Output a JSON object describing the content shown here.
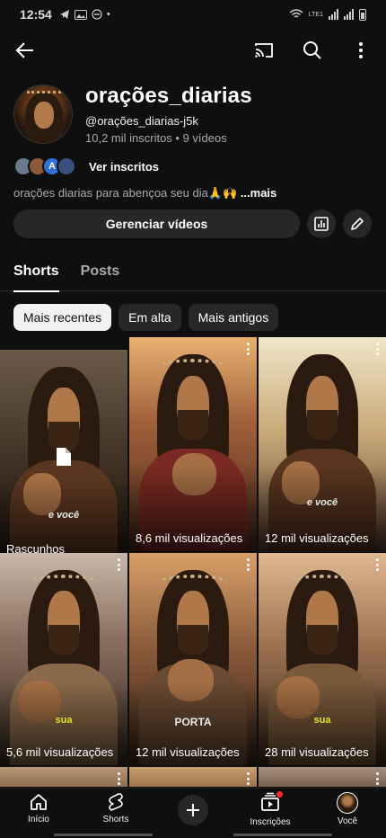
{
  "status_bar": {
    "time": "12:54",
    "network_label": "LTE1"
  },
  "top_bar": {
    "back_icon": "arrow-left-icon",
    "icons": [
      "cast-icon",
      "search-icon",
      "more-vert-icon"
    ]
  },
  "channel": {
    "name": "orações_diarias",
    "handle": "@orações_diarias-j5k",
    "stats": "10,2 mil inscritos • 9 vídeos",
    "subscribers_link": "Ver inscritos",
    "subscriber_avatar_letter": "A",
    "description": "orações diarias para abençoa seu dia🙏🙌",
    "more_label": "...mais"
  },
  "actions": {
    "manage_label": "Gerenciar vídeos",
    "analytics_icon": "analytics-icon",
    "edit_icon": "pencil-icon"
  },
  "tabs": [
    {
      "label": "Shorts",
      "active": true
    },
    {
      "label": "Posts",
      "active": false
    }
  ],
  "chips": [
    {
      "label": "Mais recentes",
      "active": true
    },
    {
      "label": "Em alta",
      "active": false
    },
    {
      "label": "Mais antigos",
      "active": false
    }
  ],
  "shorts": [
    {
      "caption": "Rascunhos",
      "overlay": "e você",
      "is_draft": true
    },
    {
      "caption": "8,6 mil visualizações",
      "overlay": ""
    },
    {
      "caption": "12 mil visualizações",
      "overlay": "e você"
    },
    {
      "caption": "5,6 mil visualizações",
      "overlay": "sua"
    },
    {
      "caption": "12 mil visualizações",
      "overlay": "PORTA"
    },
    {
      "caption": "28 mil visualizações",
      "overlay": "sua"
    }
  ],
  "bottom_nav": [
    {
      "label": "Início",
      "icon": "home-icon"
    },
    {
      "label": "Shorts",
      "icon": "shorts-icon"
    },
    {
      "label": "",
      "icon": "create-plus-icon"
    },
    {
      "label": "Inscrições",
      "icon": "subscriptions-icon"
    },
    {
      "label": "Você",
      "icon": "account-avatar-icon"
    }
  ],
  "colors": {
    "background": "#0f0f0f",
    "surface": "#272727",
    "chip_active": "#f1f1f1",
    "overlay_yellow": "#e6e22a",
    "notification": "#ff2b2b"
  }
}
